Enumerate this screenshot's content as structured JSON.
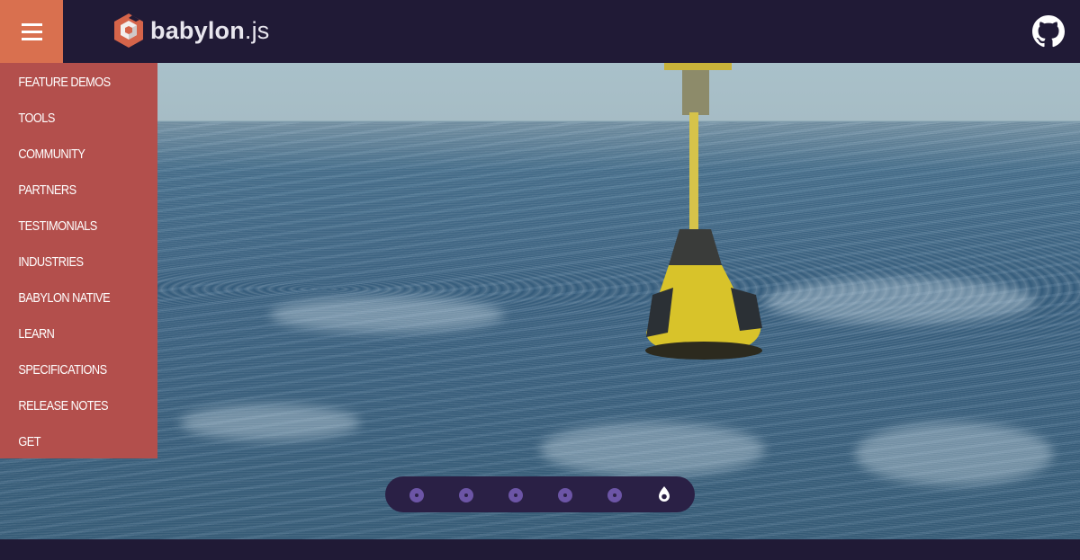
{
  "header": {
    "logo_text_bold": "babylon",
    "logo_text_suffix": ".js",
    "menu_icon": "hamburger-icon",
    "github_icon": "github-icon"
  },
  "sidebar": {
    "items": [
      {
        "label": "FEATURE DEMOS"
      },
      {
        "label": "TOOLS"
      },
      {
        "label": "COMMUNITY"
      },
      {
        "label": "PARTNERS"
      },
      {
        "label": "TESTIMONIALS"
      },
      {
        "label": "INDUSTRIES"
      },
      {
        "label": "BABYLON NATIVE"
      },
      {
        "label": "LEARN"
      },
      {
        "label": "SPECIFICATIONS"
      },
      {
        "label": "RELEASE NOTES"
      },
      {
        "label": "GET"
      }
    ]
  },
  "carousel": {
    "count": 6,
    "active_index": 5
  },
  "colors": {
    "header_bg": "#201a36",
    "menu_button": "#d9704f",
    "sidebar_bg": "#b34f4c",
    "dot": "#6c55a6",
    "carousel_bg": "#2a2045"
  }
}
